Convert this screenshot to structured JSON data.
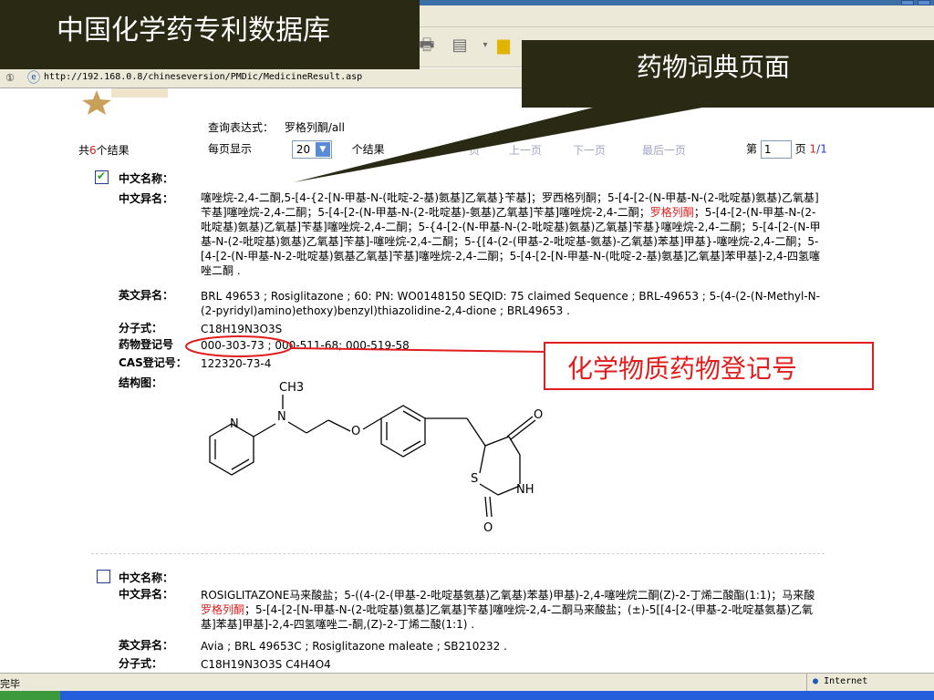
{
  "overlay": {
    "title": "中国化学药专利数据库",
    "dict_page": "药物词典页面",
    "reg_callout": "化学物质药物登记号"
  },
  "browser": {
    "address_label": "①",
    "url": "http://192.168.0.8/chineseversion/PMDic/MedicineResult.asp",
    "status_text": "完毕",
    "zone": "Internet"
  },
  "query": {
    "expr_label": "查询表达式：",
    "expr_value": "罗格列酮/all",
    "total_prefix": "共",
    "total_count": "6",
    "total_suffix": "个结果",
    "per_page_label": "每页显示",
    "per_page_value": "20",
    "per_page_suffix": "个结果",
    "first_page": "页",
    "prev_page": "上一页",
    "next_page": "下一页",
    "last_page": "最后一页",
    "page_prefix": "第",
    "page_value": "1",
    "page_suffix": "页",
    "page_current": "1",
    "page_sep": "/",
    "page_total": "1"
  },
  "record1": {
    "cn_name_label": "中文名称：",
    "cn_alias_label": "中文异名：",
    "cn_alias_a": "噻唑烷-2,4-二酮,5-[4-{2-[N-甲基-N-(吡啶-2-基)氨基]乙氧基}苄基]；罗西格列酮；5-[4-[2-(N-甲基-N-(2-吡啶基)氨基)乙氧基]苄基]噻唑烷-2,4-二酮；5-[4-[2-(N-甲基-N-(2-吡啶基)-氨基)乙氧基]苄基]噻唑烷-2,4-二酮；",
    "cn_alias_hl": "罗格列酮",
    "cn_alias_b": "；5-[4-[2-(N-甲基-N-(2-吡啶基)氨基)乙氧基]苄基]噻唑烷-2,4-二酮；5-{4-[2-(N-甲基-N-(2-吡啶基)氨基)乙氧基]苄基}噻唑烷-2,4-二酮；5-[4-[2-(N-甲基-N-(2-吡啶基)氨基)乙氧基]苄基]-噻唑烷-2,4-二酮；5-{[4-(2-(甲基-2-吡啶基-氨基)-乙氧基)苯基]甲基}-噻唑烷-2,4-二酮；5-[4-[2-(N-甲基-N-2-吡啶基)氨基乙氧基]苄基]噻唑烷-2,4-二酮；5-[4-[2-[N-甲基-N-(吡啶-2-基)氨基]乙氧基]苯甲基]-2,4-四氢噻唑二酮 .",
    "en_alias_label": "英文异名：",
    "en_alias": "BRL 49653 ; Rosiglitazone ; 60: PN: WO0148150 SEQID: 75 claimed Sequence ; BRL-49653 ; 5-(4-(2-(N-Methyl-N-(2-pyridyl)amino)ethoxy)benzyl)thiazolidine-2,4-dione ; BRL49653 .",
    "formula_label": "分子式：",
    "formula": "C18H19N3O3S",
    "drug_reg_label": "药物登记号",
    "drug_reg": "000-303-73 ; 000-511-68; 000-519-58",
    "cas_label": "CAS登记号：",
    "cas": "122320-73-4",
    "structure_label": "结构图："
  },
  "structure": {
    "ch3": "CH3",
    "n_ring": "N",
    "n_amine": "N",
    "o_ether": "O",
    "o_top": "O",
    "s": "S",
    "nh": "NH",
    "o_bottom": "O"
  },
  "record2": {
    "cn_name_label": "中文名称：",
    "cn_alias_label": "中文异名：",
    "cn_alias_a": "ROSIGLITAZONE马来酸盐；5-((4-(2-(甲基-2-吡啶基氨基)乙氧基)苯基)甲基)-2,4-噻唑烷二酮(Z)-2-丁烯二酸酯(1:1)；马来酸",
    "cn_alias_hl": "罗格列酮",
    "cn_alias_b": "；5-[4-[2-[N-甲基-N-(2-吡啶基)氨基]乙氧基]苄基]噻唑烷-2,4-二酮马来酸盐；(±)-5[[4-[2-(甲基-2-吡啶基氨基)乙氧基]苯基]甲基]-2,4-四氢噻唑二-酮,(Z)-2-丁烯二酸(1:1) .",
    "en_alias_label": "英文异名：",
    "en_alias": "Avia ; BRL 49653C ; Rosiglitazone maleate ; SB210232 .",
    "formula_label": "分子式：",
    "formula": "C18H19N3O3S C4H4O4"
  }
}
